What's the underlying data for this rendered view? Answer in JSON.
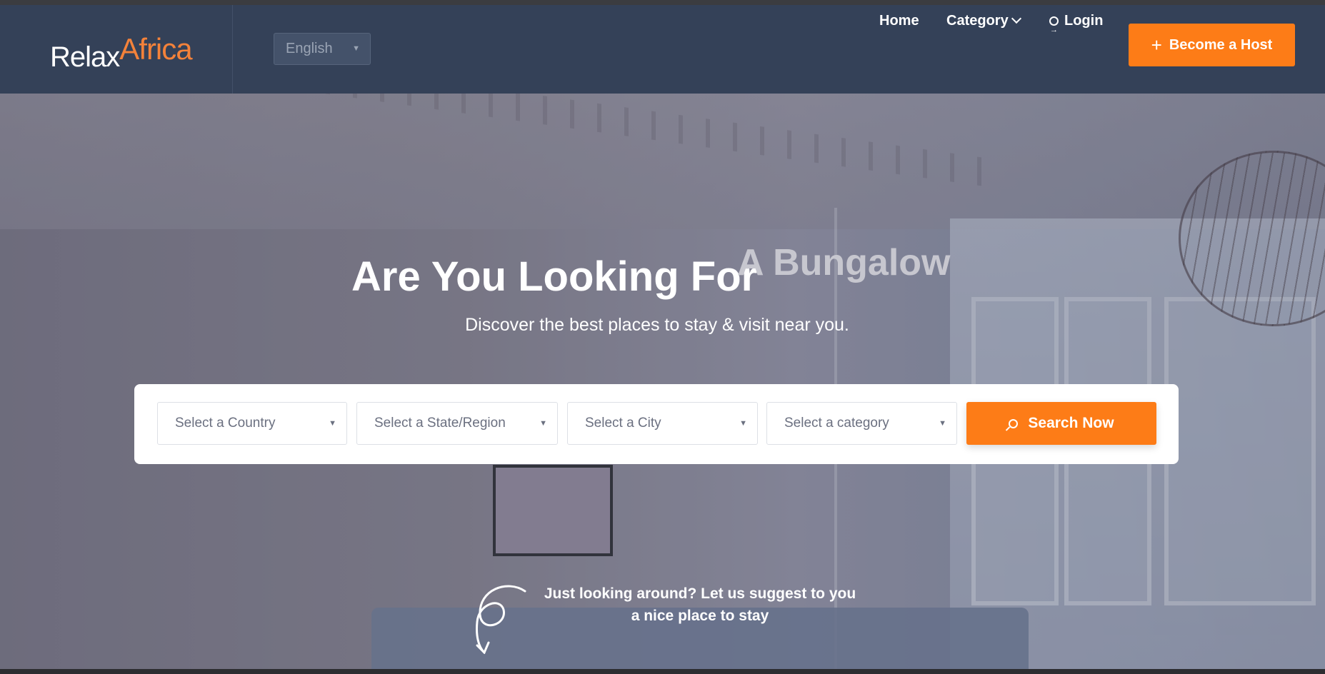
{
  "brand": {
    "part1": "Relax",
    "part2": "Africa",
    "accent_color": "#fd7c17"
  },
  "language": {
    "selected": "English"
  },
  "nav": {
    "home": "Home",
    "category": "Category",
    "login": "Login",
    "host_button": "Become a Host",
    "host_icon": "plus-icon",
    "login_icon": "login-icon",
    "category_icon": "chevron-down-icon"
  },
  "hero": {
    "headline": "Are You Looking For",
    "typed_text": "A Bungalow",
    "subheadline": "Discover the best places to stay & visit near you."
  },
  "search": {
    "country_placeholder": "Select a Country",
    "state_placeholder": "Select a State/Region",
    "city_placeholder": "Select a City",
    "category_placeholder": "Select a category",
    "button": "Search Now",
    "button_icon": "search-icon"
  },
  "suggestion": {
    "line1": "Just looking around? Let us suggest to you",
    "line2": "a nice place to stay",
    "icon": "curly-arrow-icon"
  }
}
